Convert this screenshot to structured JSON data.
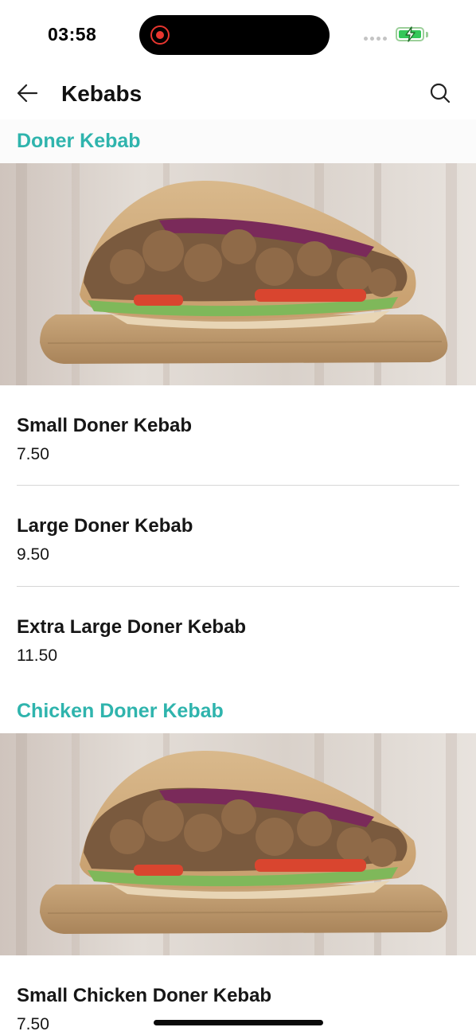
{
  "status_bar": {
    "time": "03:58",
    "battery_level": 1.0,
    "charging": true,
    "recording": true
  },
  "header": {
    "title": "Kebabs",
    "back_icon": "arrow-left-icon",
    "search_icon": "search-icon"
  },
  "sections": [
    {
      "heading": "Doner Kebab",
      "image": "doner-kebab-photo",
      "items": [
        {
          "name": "Small Doner Kebab",
          "price": "7.50"
        },
        {
          "name": "Large Doner Kebab",
          "price": "9.50"
        },
        {
          "name": "Extra Large Doner Kebab",
          "price": "11.50"
        }
      ]
    },
    {
      "heading": "Chicken Doner Kebab",
      "image": "chicken-doner-kebab-photo",
      "items": [
        {
          "name": "Small Chicken Doner Kebab",
          "price": "7.50"
        }
      ]
    }
  ],
  "colors": {
    "accent": "#2fb4ad",
    "text": "#161616",
    "divider": "#d6d6d6"
  }
}
